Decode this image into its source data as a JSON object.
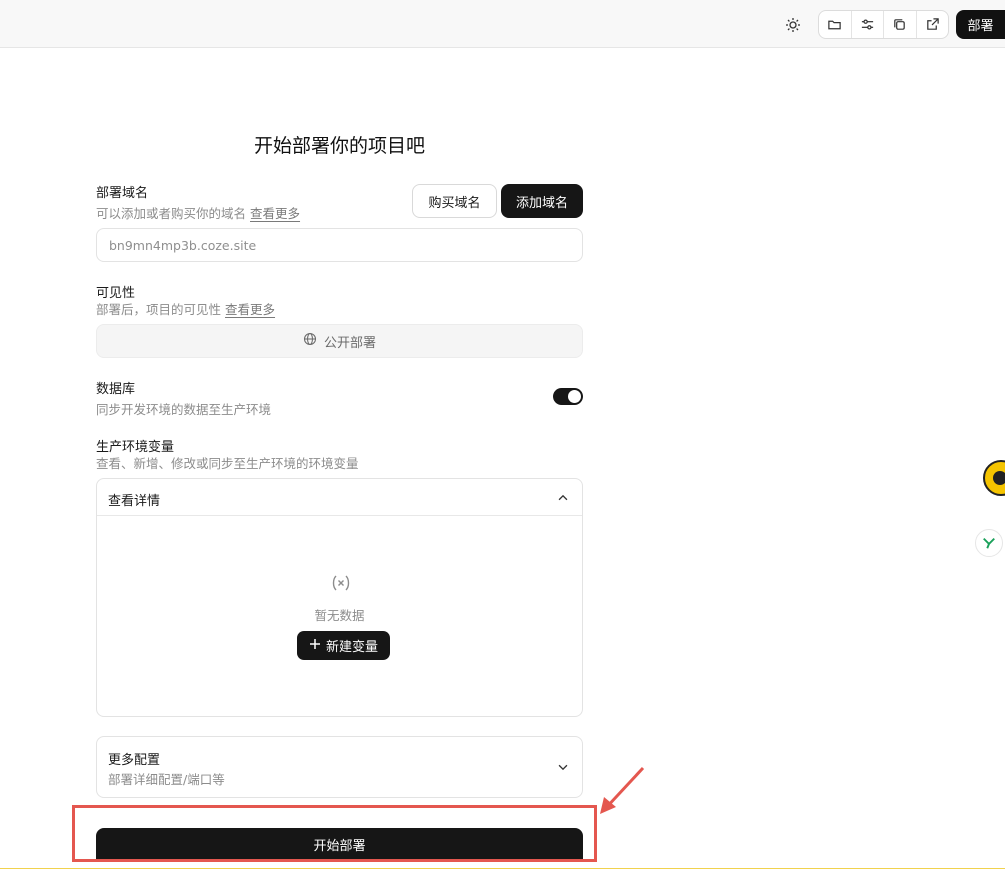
{
  "topbar": {
    "icons": [
      "sun-icon",
      "folder-icon",
      "sliders-icon",
      "copy-icon",
      "external-link-icon"
    ],
    "deploy_label": "部署"
  },
  "page_title": "开始部署你的项目吧",
  "domain": {
    "label": "部署域名",
    "desc": "可以添加或者购买你的域名",
    "link": "查看更多",
    "buy_label": "购买域名",
    "add_label": "添加域名",
    "placeholder": "bn9mn4mp3b.coze.site"
  },
  "visibility": {
    "label": "可见性",
    "desc": "部署后，项目的可见性",
    "link": "查看更多",
    "value": "公开部署"
  },
  "database": {
    "label": "数据库",
    "desc": "同步开发环境的数据至生产环境",
    "enabled": true
  },
  "env": {
    "label": "生产环境变量",
    "desc": "查看、新增、修改或同步至生产环境的环境变量",
    "panel_title": "查看详情",
    "empty_text": "暂无数据",
    "new_var_label": "新建变量"
  },
  "more": {
    "title": "更多配置",
    "desc": "部署详细配置/端口等"
  },
  "start_label": "开始部署",
  "colors": {
    "primary": "#161616",
    "highlight": "#e4574f",
    "accent_yellow": "#f5c400"
  }
}
